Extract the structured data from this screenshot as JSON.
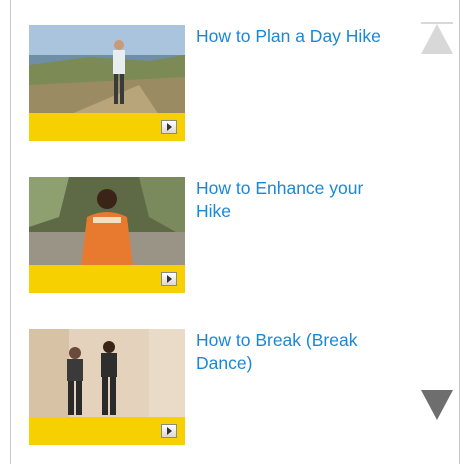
{
  "videos": [
    {
      "title": "How to Plan a Day Hike"
    },
    {
      "title": "How to Enhance your Hike"
    },
    {
      "title": "How to Break (Break Dance)"
    }
  ],
  "icons": {
    "play": "play-icon",
    "scroll_up": "scroll-up-arrow-icon",
    "scroll_down": "scroll-down-arrow-icon"
  },
  "colors": {
    "link": "#1a88d8",
    "thumb_bar": "#f7d000",
    "border": "#c8c8c8",
    "arrow_disabled": "#d8d8d8",
    "arrow_enabled": "#6e6e6e"
  }
}
